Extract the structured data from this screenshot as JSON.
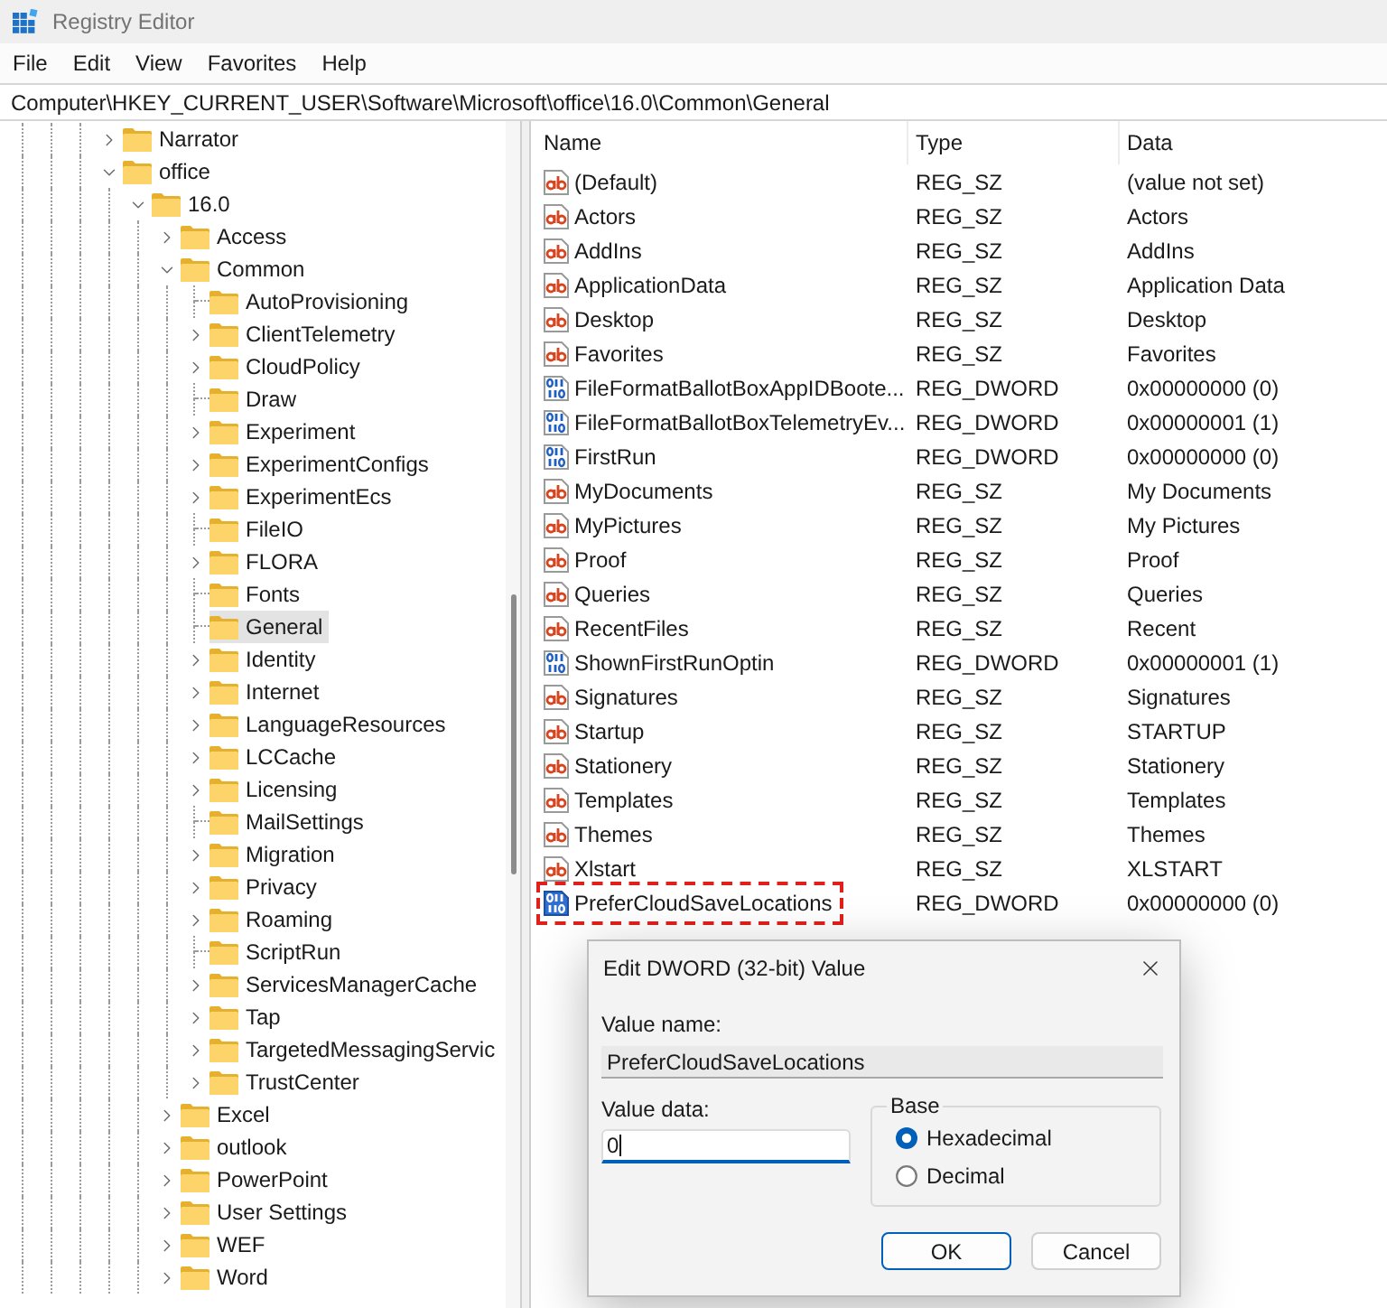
{
  "window": {
    "title": "Registry Editor"
  },
  "menu": [
    "File",
    "Edit",
    "View",
    "Favorites",
    "Help"
  ],
  "address_bar": {
    "value": "Computer\\HKEY_CURRENT_USER\\Software\\Microsoft\\office\\16.0\\Common\\General"
  },
  "tree": {
    "items": [
      {
        "label": "Narrator",
        "has_subkeys": true,
        "expanded": false,
        "selected": false
      },
      {
        "label": "office",
        "has_subkeys": true,
        "expanded": true,
        "selected": false,
        "children": [
          {
            "label": "16.0",
            "has_subkeys": true,
            "expanded": true,
            "selected": false,
            "children": [
              {
                "label": "Access",
                "has_subkeys": true,
                "expanded": false,
                "selected": false
              },
              {
                "label": "Common",
                "has_subkeys": true,
                "expanded": true,
                "selected": false,
                "children": [
                  {
                    "label": "AutoProvisioning",
                    "has_subkeys": false,
                    "expanded": false,
                    "selected": false
                  },
                  {
                    "label": "ClientTelemetry",
                    "has_subkeys": true,
                    "expanded": false,
                    "selected": false
                  },
                  {
                    "label": "CloudPolicy",
                    "has_subkeys": true,
                    "expanded": false,
                    "selected": false
                  },
                  {
                    "label": "Draw",
                    "has_subkeys": false,
                    "expanded": false,
                    "selected": false
                  },
                  {
                    "label": "Experiment",
                    "has_subkeys": true,
                    "expanded": false,
                    "selected": false
                  },
                  {
                    "label": "ExperimentConfigs",
                    "has_subkeys": true,
                    "expanded": false,
                    "selected": false
                  },
                  {
                    "label": "ExperimentEcs",
                    "has_subkeys": true,
                    "expanded": false,
                    "selected": false
                  },
                  {
                    "label": "FileIO",
                    "has_subkeys": false,
                    "expanded": false,
                    "selected": false
                  },
                  {
                    "label": "FLORA",
                    "has_subkeys": true,
                    "expanded": false,
                    "selected": false
                  },
                  {
                    "label": "Fonts",
                    "has_subkeys": false,
                    "expanded": false,
                    "selected": false
                  },
                  {
                    "label": "General",
                    "has_subkeys": false,
                    "expanded": false,
                    "selected": true
                  },
                  {
                    "label": "Identity",
                    "has_subkeys": true,
                    "expanded": false,
                    "selected": false
                  },
                  {
                    "label": "Internet",
                    "has_subkeys": true,
                    "expanded": false,
                    "selected": false
                  },
                  {
                    "label": "LanguageResources",
                    "has_subkeys": true,
                    "expanded": false,
                    "selected": false
                  },
                  {
                    "label": "LCCache",
                    "has_subkeys": true,
                    "expanded": false,
                    "selected": false
                  },
                  {
                    "label": "Licensing",
                    "has_subkeys": true,
                    "expanded": false,
                    "selected": false
                  },
                  {
                    "label": "MailSettings",
                    "has_subkeys": false,
                    "expanded": false,
                    "selected": false
                  },
                  {
                    "label": "Migration",
                    "has_subkeys": true,
                    "expanded": false,
                    "selected": false
                  },
                  {
                    "label": "Privacy",
                    "has_subkeys": true,
                    "expanded": false,
                    "selected": false
                  },
                  {
                    "label": "Roaming",
                    "has_subkeys": true,
                    "expanded": false,
                    "selected": false
                  },
                  {
                    "label": "ScriptRun",
                    "has_subkeys": false,
                    "expanded": false,
                    "selected": false
                  },
                  {
                    "label": "ServicesManagerCache",
                    "has_subkeys": true,
                    "expanded": false,
                    "selected": false
                  },
                  {
                    "label": "Tap",
                    "has_subkeys": true,
                    "expanded": false,
                    "selected": false
                  },
                  {
                    "label": "TargetedMessagingServic",
                    "has_subkeys": true,
                    "expanded": false,
                    "selected": false
                  },
                  {
                    "label": "TrustCenter",
                    "has_subkeys": true,
                    "expanded": false,
                    "selected": false
                  }
                ]
              },
              {
                "label": "Excel",
                "has_subkeys": true,
                "expanded": false,
                "selected": false
              },
              {
                "label": "outlook",
                "has_subkeys": true,
                "expanded": false,
                "selected": false
              },
              {
                "label": "PowerPoint",
                "has_subkeys": true,
                "expanded": false,
                "selected": false
              },
              {
                "label": "User Settings",
                "has_subkeys": true,
                "expanded": false,
                "selected": false
              },
              {
                "label": "WEF",
                "has_subkeys": true,
                "expanded": false,
                "selected": false
              },
              {
                "label": "Word",
                "has_subkeys": true,
                "expanded": false,
                "selected": false
              }
            ]
          }
        ]
      }
    ]
  },
  "values_list": {
    "columns": [
      "Name",
      "Type",
      "Data"
    ],
    "rows": [
      {
        "kind": "string",
        "name": "(Default)",
        "type": "REG_SZ",
        "data": "(value not set)",
        "selected": false,
        "highlighted": false
      },
      {
        "kind": "string",
        "name": "Actors",
        "type": "REG_SZ",
        "data": "Actors",
        "selected": false,
        "highlighted": false
      },
      {
        "kind": "string",
        "name": "AddIns",
        "type": "REG_SZ",
        "data": "AddIns",
        "selected": false,
        "highlighted": false
      },
      {
        "kind": "string",
        "name": "ApplicationData",
        "type": "REG_SZ",
        "data": "Application Data",
        "selected": false,
        "highlighted": false
      },
      {
        "kind": "string",
        "name": "Desktop",
        "type": "REG_SZ",
        "data": "Desktop",
        "selected": false,
        "highlighted": false
      },
      {
        "kind": "string",
        "name": "Favorites",
        "type": "REG_SZ",
        "data": "Favorites",
        "selected": false,
        "highlighted": false
      },
      {
        "kind": "dword",
        "name": "FileFormatBallotBoxAppIDBoote...",
        "type": "REG_DWORD",
        "data": "0x00000000 (0)",
        "selected": false,
        "highlighted": false
      },
      {
        "kind": "dword",
        "name": "FileFormatBallotBoxTelemetryEv...",
        "type": "REG_DWORD",
        "data": "0x00000001 (1)",
        "selected": false,
        "highlighted": false
      },
      {
        "kind": "dword",
        "name": "FirstRun",
        "type": "REG_DWORD",
        "data": "0x00000000 (0)",
        "selected": false,
        "highlighted": false
      },
      {
        "kind": "string",
        "name": "MyDocuments",
        "type": "REG_SZ",
        "data": "My Documents",
        "selected": false,
        "highlighted": false
      },
      {
        "kind": "string",
        "name": "MyPictures",
        "type": "REG_SZ",
        "data": "My Pictures",
        "selected": false,
        "highlighted": false
      },
      {
        "kind": "string",
        "name": "Proof",
        "type": "REG_SZ",
        "data": "Proof",
        "selected": false,
        "highlighted": false
      },
      {
        "kind": "string",
        "name": "Queries",
        "type": "REG_SZ",
        "data": "Queries",
        "selected": false,
        "highlighted": false
      },
      {
        "kind": "string",
        "name": "RecentFiles",
        "type": "REG_SZ",
        "data": "Recent",
        "selected": false,
        "highlighted": false
      },
      {
        "kind": "dword",
        "name": "ShownFirstRunOptin",
        "type": "REG_DWORD",
        "data": "0x00000001 (1)",
        "selected": false,
        "highlighted": false
      },
      {
        "kind": "string",
        "name": "Signatures",
        "type": "REG_SZ",
        "data": "Signatures",
        "selected": false,
        "highlighted": false
      },
      {
        "kind": "string",
        "name": "Startup",
        "type": "REG_SZ",
        "data": "STARTUP",
        "selected": false,
        "highlighted": false
      },
      {
        "kind": "string",
        "name": "Stationery",
        "type": "REG_SZ",
        "data": "Stationery",
        "selected": false,
        "highlighted": false
      },
      {
        "kind": "string",
        "name": "Templates",
        "type": "REG_SZ",
        "data": "Templates",
        "selected": false,
        "highlighted": false
      },
      {
        "kind": "string",
        "name": "Themes",
        "type": "REG_SZ",
        "data": "Themes",
        "selected": false,
        "highlighted": false
      },
      {
        "kind": "string",
        "name": "Xlstart",
        "type": "REG_SZ",
        "data": "XLSTART",
        "selected": false,
        "highlighted": false
      },
      {
        "kind": "dword",
        "name": "PreferCloudSaveLocations",
        "type": "REG_DWORD",
        "data": "0x00000000 (0)",
        "selected": true,
        "highlighted": true
      }
    ]
  },
  "dialog": {
    "title": "Edit DWORD (32-bit) Value",
    "value_name_label": "Value name:",
    "value_name": "PreferCloudSaveLocations",
    "value_data_label": "Value data:",
    "value_data": "0",
    "base": {
      "label": "Base",
      "options": [
        {
          "label": "Hexadecimal",
          "selected": true
        },
        {
          "label": "Decimal",
          "selected": false
        }
      ]
    },
    "buttons": [
      {
        "label": "OK",
        "default": true
      },
      {
        "label": "Cancel",
        "default": false
      }
    ]
  }
}
